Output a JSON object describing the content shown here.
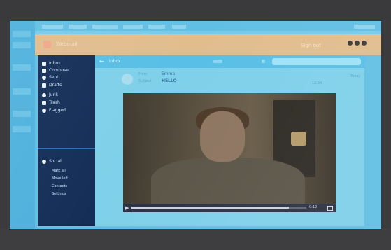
{
  "app": {
    "title": "Webmail",
    "user": "Sign out"
  },
  "sidebar": {
    "items": [
      {
        "label": "Inbox",
        "icon": "home-icon"
      },
      {
        "label": "Compose",
        "icon": "pencil-icon"
      },
      {
        "label": "Sent",
        "icon": "heart-icon"
      },
      {
        "label": "Drafts",
        "icon": "doc-icon"
      },
      {
        "label": "Junk",
        "icon": "star-icon"
      },
      {
        "label": "Trash",
        "icon": "trash-icon"
      },
      {
        "label": "Flagged",
        "icon": "flag-icon"
      }
    ],
    "section_title": "Social",
    "sub_items": [
      "Mark all",
      "Move left",
      "Contacts",
      "Settings"
    ]
  },
  "toolbar": {
    "inbox_label": "Inbox"
  },
  "message": {
    "from_key": "From",
    "from_value": "Emma",
    "subject_key": "Subject",
    "subject_value": "HELLO",
    "date": "Today",
    "date2": "12:34"
  },
  "video": {
    "progress": 0.9,
    "time": "0:12"
  },
  "colors": {
    "screen": "#62bfe4",
    "sidebar": "#142e57",
    "header": "#e1bd8e"
  }
}
